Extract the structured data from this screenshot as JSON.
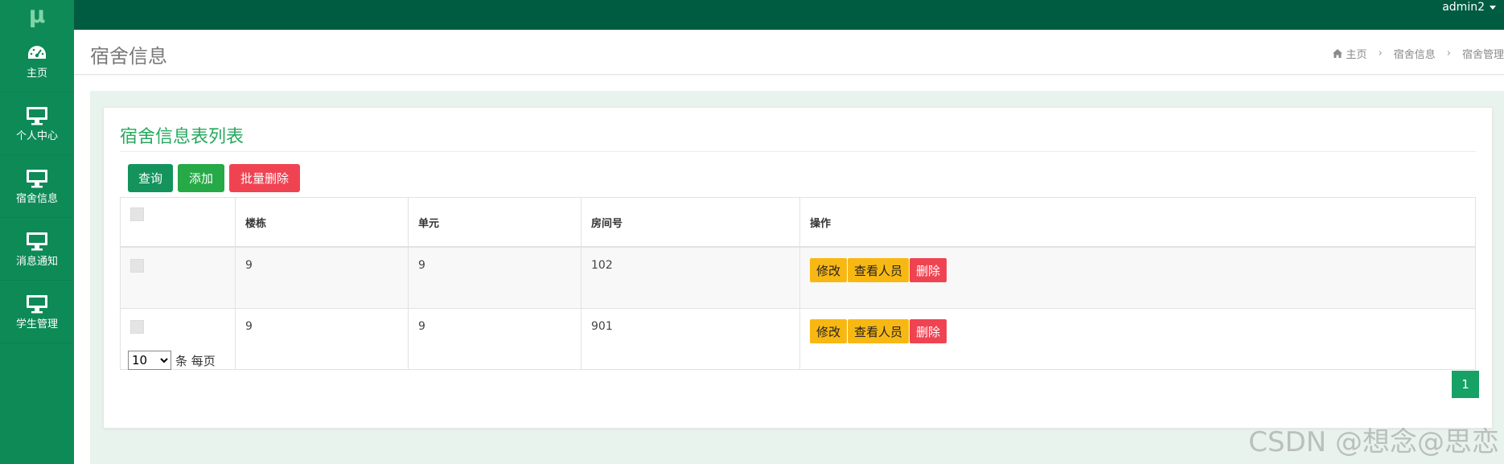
{
  "app": {
    "logo_text": "μ",
    "user_label": "admin2"
  },
  "sidebar": {
    "items": [
      {
        "label": "主页",
        "icon": "dashboard-icon"
      },
      {
        "label": "个人中心",
        "icon": "monitor-icon"
      },
      {
        "label": "宿舍信息",
        "icon": "monitor-icon"
      },
      {
        "label": "消息通知",
        "icon": "monitor-icon"
      },
      {
        "label": "学生管理",
        "icon": "monitor-icon"
      }
    ]
  },
  "header": {
    "title": "宿舍信息",
    "breadcrumb": [
      "主页",
      "宿舍信息",
      "宿舍管理"
    ]
  },
  "card": {
    "title": "宿舍信息表列表",
    "buttons": {
      "query": "查询",
      "add": "添加",
      "batch_delete": "批量删除"
    }
  },
  "table": {
    "columns": [
      "楼栋",
      "单元",
      "房间号",
      "操作"
    ],
    "rows": [
      {
        "building": "9",
        "unit": "9",
        "room": "102"
      },
      {
        "building": "9",
        "unit": "9",
        "room": "901"
      }
    ],
    "row_actions": {
      "edit": "修改",
      "view_members": "查看人员",
      "delete": "删除"
    }
  },
  "pagination": {
    "page_size": "10",
    "page_size_options": [
      "10"
    ],
    "per_page_label": "条 每页",
    "current_page": "1"
  },
  "watermark": "CSDN @想念@思恋",
  "colors": {
    "sidebar": "#0e8a57",
    "topbar": "#005c40",
    "accent_green": "#27a85f",
    "danger": "#f04352",
    "warning": "#f8b814"
  }
}
